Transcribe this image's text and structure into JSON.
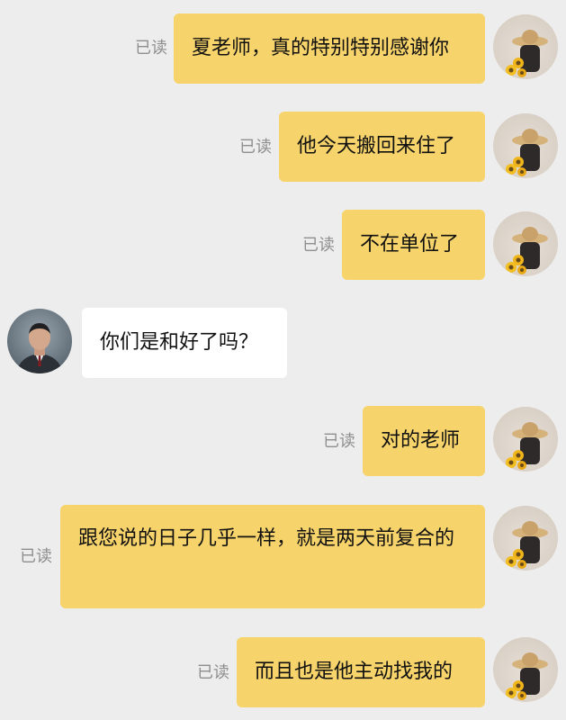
{
  "read_label": "已读",
  "messages": [
    {
      "side": "right",
      "text": "夏老师，真的特别特别感谢你",
      "read": "已读"
    },
    {
      "side": "right",
      "text": "他今天搬回来住了",
      "read": "已读"
    },
    {
      "side": "right",
      "text": "不在单位了",
      "read": "已读"
    },
    {
      "side": "left",
      "text": "你们是和好了吗？"
    },
    {
      "side": "right",
      "text": "对的老师",
      "read": "已读"
    },
    {
      "side": "right",
      "text": "跟您说的日子几乎一样，就是两天前复合的",
      "read": "已读"
    },
    {
      "side": "right",
      "text": "而且也是他主动找我的",
      "read": "已读"
    }
  ],
  "colors": {
    "background": "#ededed",
    "self_bubble": "#f6d36b",
    "other_bubble": "#ffffff",
    "read_status": "#8e8e8e"
  },
  "icons": {
    "self_avatar": "straw-hat-sunflower-avatar-icon",
    "other_avatar": "man-in-suit-avatar-icon"
  }
}
